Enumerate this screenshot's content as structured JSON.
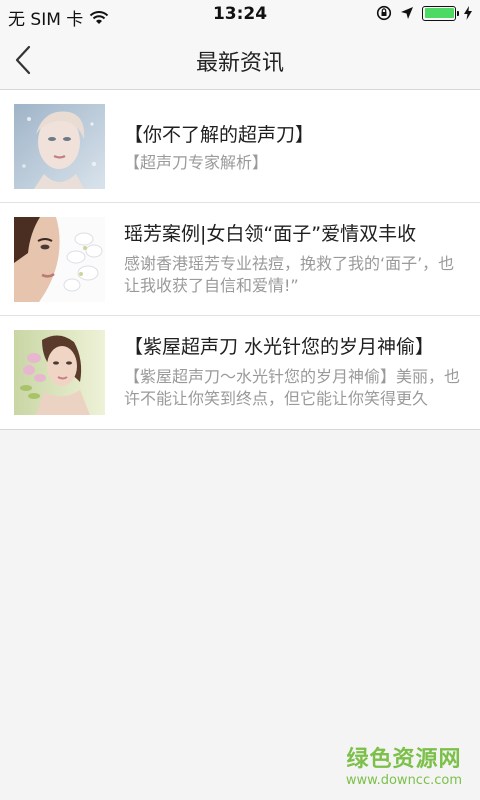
{
  "status_bar": {
    "carrier": "无 SIM 卡",
    "time": "13:24",
    "icons": [
      "wifi-icon",
      "lock-rotation-icon",
      "location-icon",
      "battery-icon",
      "charging-icon"
    ],
    "battery_level": 1.0,
    "battery_color": "#4cd964"
  },
  "nav": {
    "title": "最新资讯",
    "back_icon": "chevron-left-icon"
  },
  "news": [
    {
      "title": "【你不了解的超声刀】",
      "summary": "【超声刀专家解析】"
    },
    {
      "title": "瑶芳案例|女白领“面子”爱情双丰收",
      "summary": "感谢香港瑶芳专业祛痘，挽救了我的‘面子’，也让我收获了自信和爱情!”"
    },
    {
      "title": "【紫屋超声刀 水光针您的岁月神偷】",
      "summary": "【紫屋超声刀～水光针您的岁月神偷】美丽，也许不能让你笑到终点，但它能让你笑得更久"
    }
  ],
  "watermark": {
    "title": "绿色资源网",
    "url": "www.downcc.com"
  }
}
